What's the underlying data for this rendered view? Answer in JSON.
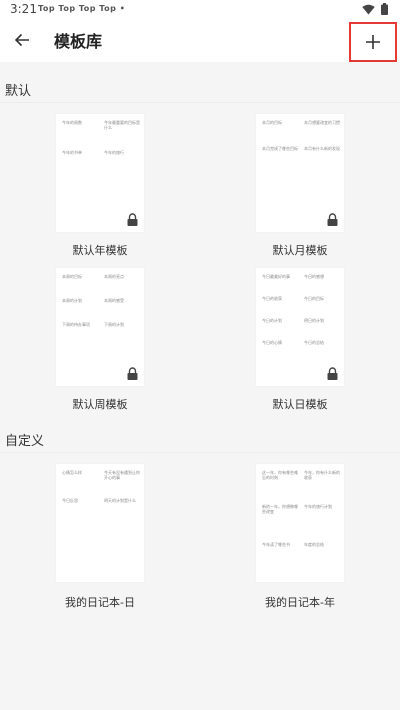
{
  "status_bar": {
    "time": "3:21",
    "notifications": [
      "Top",
      "Top",
      "Top",
      "Top",
      "•"
    ],
    "icons": [
      "wifi-icon",
      "battery-icon"
    ]
  },
  "app_bar": {
    "title": "模板库",
    "back_icon": "arrow-left-icon",
    "add_icon": "plus-icon"
  },
  "sections": [
    {
      "label": "默认",
      "cards": [
        {
          "name": "默认年模板",
          "locked": true,
          "cells": [
            "今年的周数",
            "今年最重要的目标是什么",
            "今年的书单",
            "今年的旅行"
          ]
        },
        {
          "name": "默认月模板",
          "locked": true,
          "cells": [
            "本月的目标",
            "本月想要改变的习惯",
            "本月完成了哪些目标",
            "本月有什么新的发现"
          ]
        },
        {
          "name": "默认周模板",
          "locked": true,
          "cells": [
            "本周的目标",
            "本周的亮点",
            "本周的计划",
            "本周的感受",
            "下周的待办事项",
            "下周的计划"
          ]
        },
        {
          "name": "默认日模板",
          "locked": true,
          "cells": [
            "今日最美好的事",
            "今日的感想",
            "今日的收获",
            "今日的目标",
            "今日的计划",
            "明日的计划",
            "今日的心情",
            "今日的总结"
          ]
        }
      ]
    },
    {
      "label": "自定义",
      "cards": [
        {
          "name": "我的日记本-日",
          "locked": false,
          "cells": [
            "心情怎么样",
            "今天有没有遇到让你开心的事",
            "今日反思",
            "明天的计划是什么"
          ]
        },
        {
          "name": "我的日记本-年",
          "locked": false,
          "cells": [
            "这一年，你有哪些难忘的时刻",
            "今年，你有什么新的收获",
            "新的一年，你想做哪些改变",
            "今年的旅行计划",
            "今年读了哪些书",
            "年度的总结"
          ]
        }
      ]
    }
  ],
  "colors": {
    "highlight_border": "#e53935",
    "background": "#f5f5f5",
    "card": "#ffffff"
  }
}
